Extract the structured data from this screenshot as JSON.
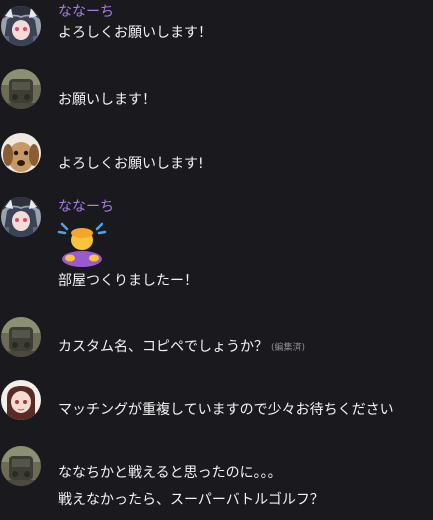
{
  "messages": [
    {
      "author": "ななーち",
      "text": "よろしくお願いします！"
    },
    {
      "text": "お願いします！"
    },
    {
      "text": "よろしくお願いします!"
    },
    {
      "author": "ななーち",
      "emoji": "person-bowing-emoji",
      "text": "部屋つくりましたー！"
    },
    {
      "text": "カスタム名、コピペでしょうか？",
      "edited_label": "(編集済)"
    },
    {
      "text": "マッチングが重複していますので少々お待ちください"
    },
    {
      "text_line1": "ななちかと戦えると思ったのに。。。",
      "text_line2": "戦えなかったら、スーパーバトルゴルフ？"
    }
  ],
  "colors": {
    "background": "#1a1a1e",
    "username": "#a97be6",
    "message_text": "#f2f3f5",
    "muted": "#8c8f96"
  }
}
